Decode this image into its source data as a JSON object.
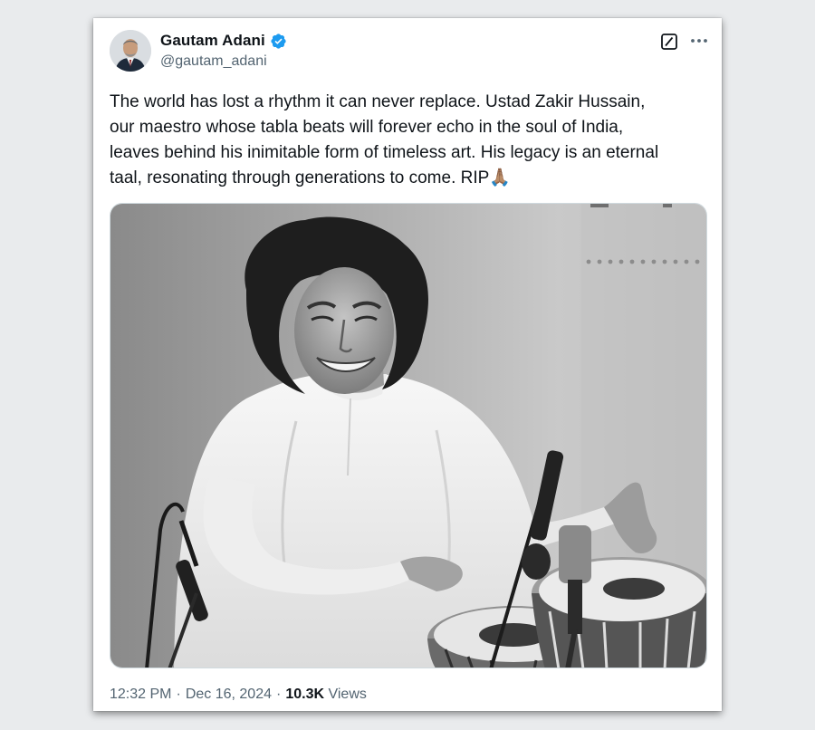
{
  "post": {
    "author": {
      "name": "Gautam Adani",
      "handle": "@gautam_adani",
      "verified": true
    },
    "text": "The world has lost a rhythm it can never replace. Ustad Zakir Hussain,\nour maestro whose tabla beats will forever echo in the soul of India,\nleaves behind his inimitable form of timeless art. His legacy is an eternal\ntaal, resonating through generations to come. RIP🙏🏽",
    "image": {
      "icon": "photo-of-musician-with-tabla",
      "style": "black-and-white"
    },
    "meta": {
      "time": "12:32 PM",
      "separator": "·",
      "date": "Dec 16, 2024",
      "views_count": "10.3K",
      "views_label": "Views"
    }
  },
  "colors": {
    "accent": "#1d9bf0",
    "text": "#0f1419",
    "muted": "#536471"
  }
}
